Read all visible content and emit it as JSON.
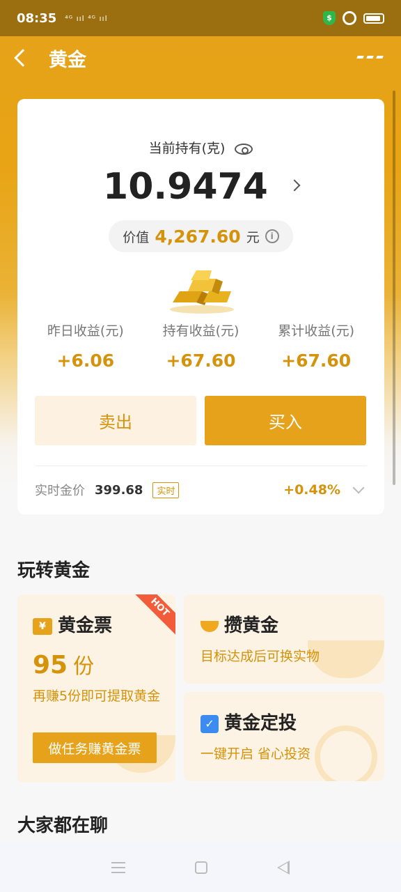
{
  "status_bar": {
    "time": "08:35",
    "network": "⁴ᴳ ııl ⁴ᴳ ııl"
  },
  "nav": {
    "title": "黄金"
  },
  "holding": {
    "label": "当前持有(克)",
    "value": "10.9474",
    "worth_label": "价值",
    "worth_amount": "4,267.60",
    "worth_unit": "元"
  },
  "stats": [
    {
      "label": "昨日收益(元)",
      "value": "+6.06"
    },
    {
      "label": "持有收益(元)",
      "value": "+67.60"
    },
    {
      "label": "累计收益(元)",
      "value": "+67.60"
    }
  ],
  "actions": {
    "sell_label": "卖出",
    "buy_label": "买入"
  },
  "gold_price": {
    "label": "实时金价",
    "value": "399.68",
    "badge": "实时",
    "change": "+0.48%"
  },
  "section_play": {
    "title": "玩转黄金",
    "ticket": {
      "icon_text": "¥",
      "title": "黄金票",
      "hot": "HOT",
      "count": "95",
      "unit": "份",
      "desc": "再赚5份即可提取黄金",
      "button": "做任务赚黄金票"
    },
    "save": {
      "title": "攒黄金",
      "desc": "目标达成后可换实物"
    },
    "invest": {
      "title": "黄金定投",
      "desc": "一键开启 省心投资"
    }
  },
  "section_chat": {
    "title": "大家都在聊"
  },
  "colors": {
    "brand": "#e6a21a",
    "accent_text": "#d4930b"
  }
}
